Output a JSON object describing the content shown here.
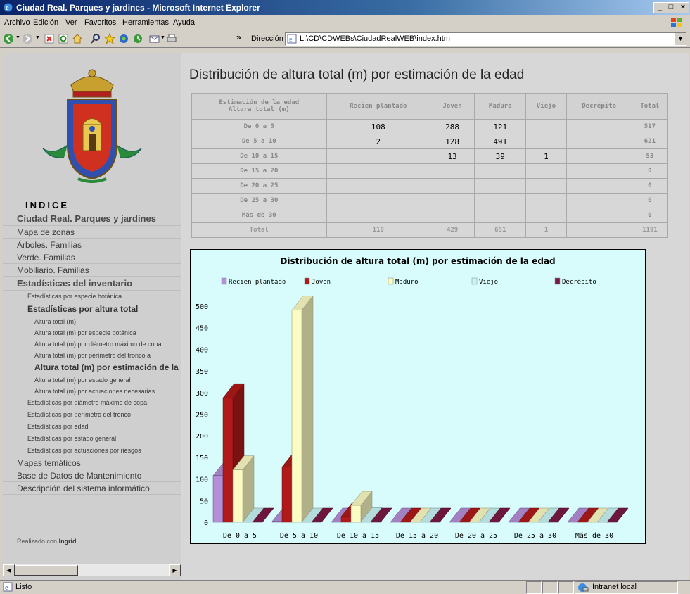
{
  "window": {
    "title": "Ciudad Real. Parques y jardines - Microsoft Internet Explorer"
  },
  "menu": [
    "Archivo",
    "Edición",
    "Ver",
    "Favoritos",
    "Herramientas",
    "Ayuda"
  ],
  "toolbar": {
    "address_label": "Dirección",
    "address_value": "L:\\CD\\CDWEBs\\CiudadRealWEB\\index.htm",
    "more": "»"
  },
  "sidebar": {
    "indice": "INDICE",
    "items": [
      {
        "label": "Ciudad Real. Parques y jardines",
        "level": 0,
        "style": "main"
      },
      {
        "label": "Mapa de zonas",
        "level": 0
      },
      {
        "label": "Árboles. Familias",
        "level": 0
      },
      {
        "label": "Verde. Familias",
        "level": 0
      },
      {
        "label": "Mobiliario. Familias",
        "level": 0
      },
      {
        "label": "Estadísticas del inventario",
        "level": 0,
        "style": "main"
      },
      {
        "label": "Estadísticas por especie botánica",
        "level": 1
      },
      {
        "label": "Estadísticas por altura total",
        "level": 1,
        "style": "bold"
      },
      {
        "label": "Altura total (m)",
        "level": 2
      },
      {
        "label": "Altura total (m) por especie botánica",
        "level": 2
      },
      {
        "label": "Altura total (m) por diámetro máximo de copa",
        "level": 2
      },
      {
        "label": "Altura total (m) por perímetro del tronco a",
        "level": 2
      },
      {
        "label": "Altura total (m) por estimación de la edad",
        "level": 2,
        "style": "active"
      },
      {
        "label": "Altura total (m) por estado general",
        "level": 2
      },
      {
        "label": "Altura total (m) por actuaciones necesarias",
        "level": 2
      },
      {
        "label": "Estadísticas por diámetro máximo de copa",
        "level": 1
      },
      {
        "label": "Estadísticas por perímetro del tronco",
        "level": 1
      },
      {
        "label": "Estadísticas por edad",
        "level": 1
      },
      {
        "label": "Estadísticas por estado general",
        "level": 1
      },
      {
        "label": "Estadísticas por actuaciones por riesgos",
        "level": 1
      },
      {
        "label": "Mapas temáticos",
        "level": 0
      },
      {
        "label": "Base de Datos de Mantenimiento",
        "level": 0
      },
      {
        "label": "Descripción del sistema informático",
        "level": 0
      }
    ],
    "made_with_prefix": "Realizado con",
    "made_with_name": "Ingrid"
  },
  "main": {
    "title": "Distribución de altura total (m) por estimación de la edad",
    "table": {
      "header_col0_line1": "Estimación de la edad",
      "header_col0_line2": "Altura total (m)",
      "columns": [
        "Recien plantado",
        "Joven",
        "Maduro",
        "Viejo",
        "Decrépito",
        "Total"
      ],
      "rows": [
        {
          "label": "De 0 a 5",
          "cells": [
            "108",
            "288",
            "121",
            "",
            "",
            "517"
          ]
        },
        {
          "label": "De 5 a 10",
          "cells": [
            "2",
            "128",
            "491",
            "",
            "",
            "621"
          ]
        },
        {
          "label": "De 10 a 15",
          "cells": [
            "",
            "13",
            "39",
            "1",
            "",
            "53"
          ]
        },
        {
          "label": "De 15 a 20",
          "cells": [
            "",
            "",
            "",
            "",
            "",
            "0"
          ]
        },
        {
          "label": "De 20 a 25",
          "cells": [
            "",
            "",
            "",
            "",
            "",
            "0"
          ]
        },
        {
          "label": "De 25 a 30",
          "cells": [
            "",
            "",
            "",
            "",
            "",
            "0"
          ]
        },
        {
          "label": "Más de 30",
          "cells": [
            "",
            "",
            "",
            "",
            "",
            "0"
          ]
        }
      ],
      "total_row": {
        "label": "Total",
        "cells": [
          "110",
          "429",
          "651",
          "1",
          "",
          "1191"
        ]
      }
    }
  },
  "chart_data": {
    "type": "bar",
    "title": "Distribución de altura total (m) por estimación de la edad",
    "categories": [
      "De 0 a 5",
      "De 5 a 10",
      "De 10 a 15",
      "De 15 a 20",
      "De 20 a 25",
      "De 25 a 30",
      "Más de 30"
    ],
    "series": [
      {
        "name": "Recien plantado",
        "color": "#b48ed8",
        "values": [
          108,
          2,
          0,
          0,
          0,
          0,
          0
        ]
      },
      {
        "name": "Joven",
        "color": "#b01a1a",
        "values": [
          288,
          128,
          13,
          0,
          0,
          0,
          0
        ]
      },
      {
        "name": "Maduro",
        "color": "#fbfbc4",
        "values": [
          121,
          491,
          39,
          0,
          0,
          0,
          0
        ]
      },
      {
        "name": "Viejo",
        "color": "#c8f4f4",
        "values": [
          0,
          0,
          1,
          0,
          0,
          0,
          0
        ]
      },
      {
        "name": "Decrépito",
        "color": "#7a1a44",
        "values": [
          0,
          0,
          0,
          0,
          0,
          0,
          0
        ]
      }
    ],
    "yticks": [
      0,
      50,
      100,
      150,
      200,
      250,
      300,
      350,
      400,
      450,
      500
    ],
    "ylim": [
      0,
      500
    ],
    "legend": "top",
    "style": "3d"
  },
  "statusbar": {
    "text": "Listo",
    "zone": "Intranet local"
  }
}
